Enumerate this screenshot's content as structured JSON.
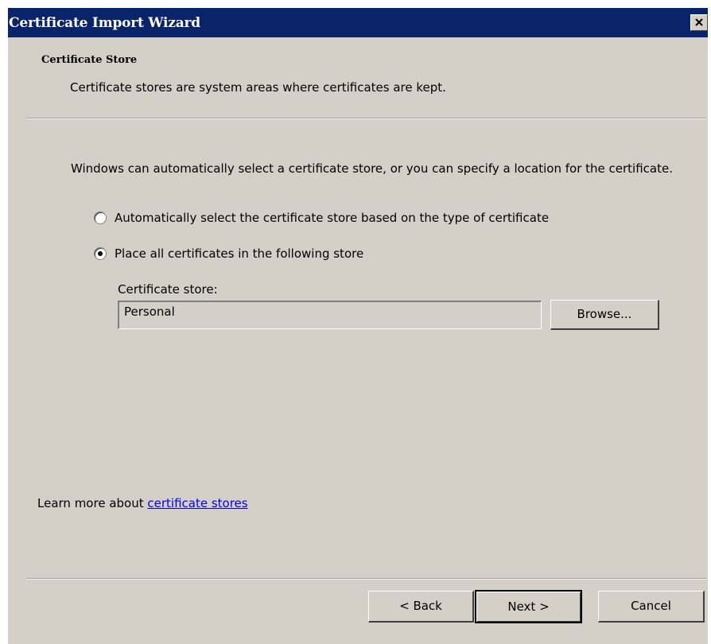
{
  "window": {
    "title": "Certificate Import Wizard",
    "close_icon": "close-icon"
  },
  "header": {
    "title": "Certificate Store",
    "subtitle": "Certificate stores are system areas where certificates are kept."
  },
  "body": {
    "intro": "Windows can automatically select a certificate store, or you can specify a location for the certificate.",
    "options": [
      {
        "label": "Automatically select the certificate store based on the type of certificate",
        "selected": false
      },
      {
        "label": "Place all certificates in the following store",
        "selected": true
      }
    ],
    "store_label": "Certificate store:",
    "store_value": "Personal",
    "browse_label": "Browse..."
  },
  "footer": {
    "learn_more_prefix": "Learn more about ",
    "learn_more_link": "certificate stores",
    "back_label": "< Back",
    "next_label": "Next >",
    "cancel_label": "Cancel"
  },
  "colors": {
    "titlebar": "#0a246a",
    "dialog_bg": "#d4d0c8",
    "link": "#0000ff"
  }
}
